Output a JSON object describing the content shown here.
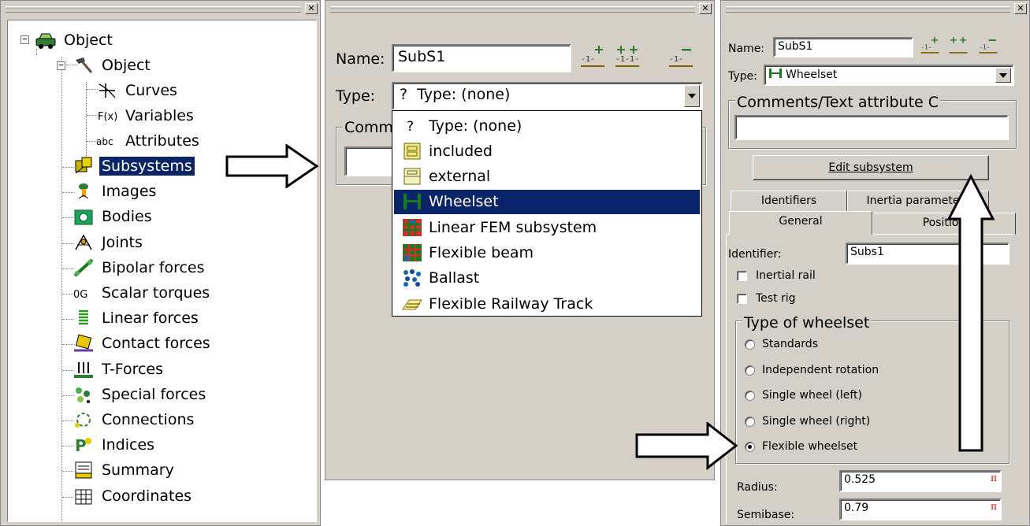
{
  "tree_panel": {
    "close_glyph": "✕",
    "root": {
      "label": "Object"
    },
    "child_object": {
      "label": "Object"
    },
    "sub_items": [
      {
        "label": "Curves",
        "icon": "curves-icon"
      },
      {
        "label": "Variables",
        "icon": "variables-icon"
      },
      {
        "label": "Attributes",
        "icon": "attributes-icon"
      }
    ],
    "items": [
      {
        "label": "Subsystems",
        "icon": "subsystems-icon",
        "selected": true
      },
      {
        "label": "Images",
        "icon": "images-icon"
      },
      {
        "label": "Bodies",
        "icon": "bodies-icon"
      },
      {
        "label": "Joints",
        "icon": "joints-icon"
      },
      {
        "label": "Bipolar forces",
        "icon": "bipolar-forces-icon"
      },
      {
        "label": "Scalar torques",
        "icon": "scalar-torques-icon"
      },
      {
        "label": "Linear forces",
        "icon": "linear-forces-icon"
      },
      {
        "label": "Contact forces",
        "icon": "contact-forces-icon"
      },
      {
        "label": "T-Forces",
        "icon": "t-forces-icon"
      },
      {
        "label": "Special forces",
        "icon": "special-forces-icon"
      },
      {
        "label": "Connections",
        "icon": "connections-icon"
      },
      {
        "label": "Indices",
        "icon": "indices-icon"
      },
      {
        "label": "Summary",
        "icon": "summary-icon"
      },
      {
        "label": "Coordinates",
        "icon": "coordinates-icon"
      }
    ]
  },
  "panel2": {
    "close_glyph": "✕",
    "name_label": "Name:",
    "name_value": "SubS1",
    "type_label": "Type:",
    "type_value": "Type: (none)",
    "type_glyph": "?",
    "comments_partial": "Comm",
    "dropdown": [
      {
        "label": "Type: (none)",
        "icon": "question-icon"
      },
      {
        "label": "included",
        "icon": "included-icon"
      },
      {
        "label": "external",
        "icon": "external-icon"
      },
      {
        "label": "Wheelset",
        "icon": "wheelset-icon",
        "selected": true
      },
      {
        "label": "Linear FEM subsystem",
        "icon": "fem-icon"
      },
      {
        "label": "Flexible beam",
        "icon": "flexible-beam-icon"
      },
      {
        "label": "Ballast",
        "icon": "ballast-icon"
      },
      {
        "label": "Flexible Railway Track",
        "icon": "railway-track-icon"
      }
    ]
  },
  "panel3": {
    "close_glyph": "✕",
    "name_label": "Name:",
    "name_value": "SubS1",
    "type_label": "Type:",
    "type_value": "Wheelset",
    "comments_title": "Comments/Text attribute C",
    "comments_value": "",
    "edit_button": "Edit subsystem",
    "tabs_row1": [
      "Identifiers",
      "Inertia parameters"
    ],
    "tabs_row2": [
      "General",
      "Position"
    ],
    "identifier_label": "Identifier:",
    "identifier_value": "Subs1",
    "inertial_rail": "Inertial rail",
    "test_rig": "Test rig",
    "wheelset_group_title": "Type of wheelset",
    "wheelset_options": [
      "Standards",
      "Independent rotation",
      "Single wheel (left)",
      "Single wheel (right)",
      "Flexible wheelset"
    ],
    "wheelset_selected": "Flexible wheelset",
    "radius_label": "Radius:",
    "radius_value": "0.525",
    "semibase_label": "Semibase:",
    "semibase_value": "0.79",
    "pi_mark": "π"
  }
}
